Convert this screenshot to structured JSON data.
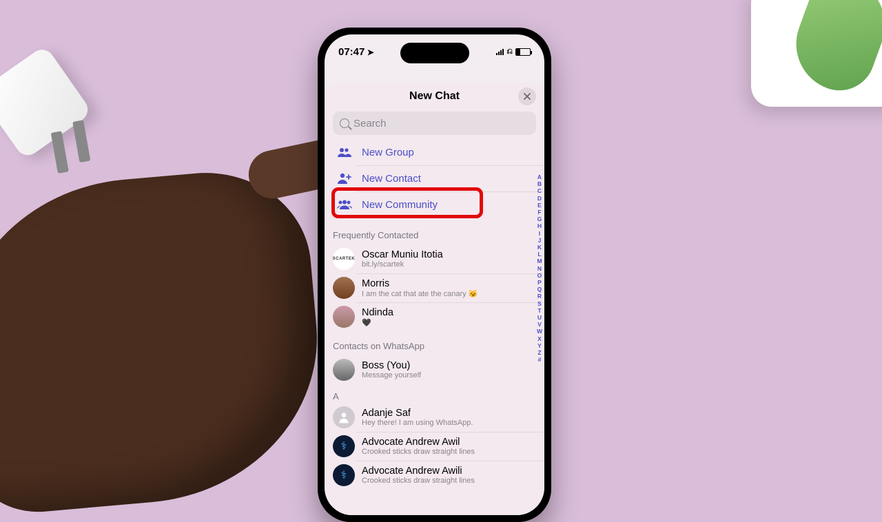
{
  "statusbar": {
    "time": "07:47"
  },
  "sheet": {
    "title": "New Chat",
    "search_placeholder": "Search",
    "actions": [
      {
        "icon": "group-icon",
        "label": "New Group"
      },
      {
        "icon": "add-contact-icon",
        "label": "New Contact"
      },
      {
        "icon": "community-icon",
        "label": "New Community"
      }
    ]
  },
  "sections": {
    "freq_title": "Frequently Contacted",
    "freq": [
      {
        "name": "Oscar Muniu Itotia",
        "status": "bit.ly/scartek",
        "avatar": "scartek"
      },
      {
        "name": "Morris",
        "status": "I am the cat that ate the canary 😼",
        "avatar": "img"
      },
      {
        "name": "Ndinda",
        "status": "🖤",
        "avatar": "img"
      }
    ],
    "contacts_title": "Contacts on WhatsApp",
    "you": {
      "name": "Boss (You)",
      "status": "Message yourself",
      "avatar": "img"
    },
    "letter": "A",
    "a_list": [
      {
        "name": "Adanje Saf",
        "status": "Hey there! I am using WhatsApp.",
        "avatar": "placeholder"
      },
      {
        "name": "Advocate Andrew Awil",
        "status": "Crooked sticks draw straight lines",
        "avatar": "dark"
      },
      {
        "name": "Advocate Andrew Awili",
        "status": "Crooked sticks draw straight lines",
        "avatar": "dark"
      }
    ]
  },
  "index_letters": [
    "A",
    "B",
    "C",
    "D",
    "E",
    "F",
    "G",
    "H",
    "I",
    "J",
    "K",
    "L",
    "M",
    "N",
    "O",
    "P",
    "Q",
    "R",
    "S",
    "T",
    "U",
    "V",
    "W",
    "X",
    "Y",
    "Z",
    "#"
  ]
}
